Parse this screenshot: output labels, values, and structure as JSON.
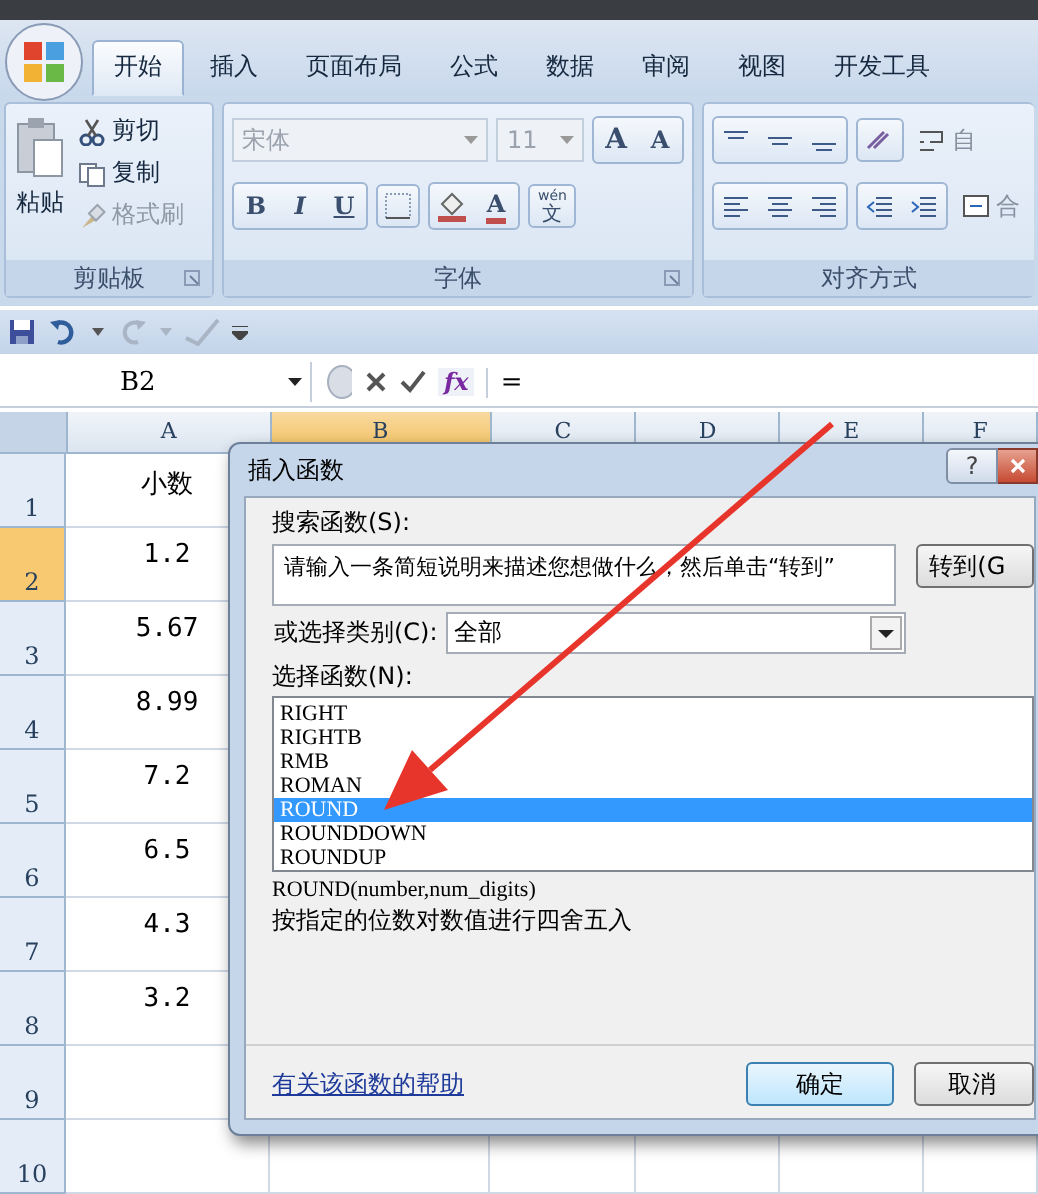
{
  "tabs": [
    {
      "label": "开始",
      "selected": true
    },
    {
      "label": "插入",
      "selected": false
    },
    {
      "label": "页面布局",
      "selected": false
    },
    {
      "label": "公式",
      "selected": false
    },
    {
      "label": "数据",
      "selected": false
    },
    {
      "label": "审阅",
      "selected": false
    },
    {
      "label": "视图",
      "selected": false
    },
    {
      "label": "开发工具",
      "selected": false
    }
  ],
  "clipboard": {
    "paste": "粘贴",
    "cut": "剪切",
    "copy": "复制",
    "painter": "格式刷",
    "label": "剪贴板"
  },
  "font": {
    "name": "宋体",
    "size": "11",
    "grow": "A",
    "shrink": "A",
    "bold": "B",
    "italic": "I",
    "underline": "U",
    "color_letter": "A",
    "phonetic_top": "wén",
    "phonetic_bottom": "文",
    "label": "字体"
  },
  "alignment": {
    "wrap": "自",
    "merge": "合",
    "label": "对齐方式"
  },
  "formula_bar": {
    "name_box": "B2",
    "fx": "fx",
    "formula": "="
  },
  "columns": [
    {
      "label": "A",
      "selected": false
    },
    {
      "label": "B",
      "selected": true
    },
    {
      "label": "C",
      "selected": false
    },
    {
      "label": "D",
      "selected": false
    },
    {
      "label": "E",
      "selected": false
    },
    {
      "label": "F",
      "selected": false
    }
  ],
  "rows": [
    {
      "number": "1",
      "a": "小数",
      "selected": false
    },
    {
      "number": "2",
      "a": "1.2",
      "selected": true
    },
    {
      "number": "3",
      "a": "5.67",
      "selected": false
    },
    {
      "number": "4",
      "a": "8.99",
      "selected": false
    },
    {
      "number": "5",
      "a": "7.2",
      "selected": false
    },
    {
      "number": "6",
      "a": "6.5",
      "selected": false
    },
    {
      "number": "7",
      "a": "4.3",
      "selected": false
    },
    {
      "number": "8",
      "a": "3.2",
      "selected": false
    },
    {
      "number": "9",
      "selected": false
    },
    {
      "number": "10",
      "selected": false
    }
  ],
  "dialog": {
    "title": "插入函数",
    "help": "?",
    "search_label": "搜索函数(S):",
    "search_value": "请输入一条简短说明来描述您想做什么，然后单击“转到”",
    "go_button": "转到(G",
    "category_label": "或选择类别(C):",
    "category": "全部",
    "list_label": "选择函数(N):",
    "functions": [
      {
        "name": "RIGHT",
        "selected": false
      },
      {
        "name": "RIGHTB",
        "selected": false
      },
      {
        "name": "RMB",
        "selected": false
      },
      {
        "name": "ROMAN",
        "selected": false
      },
      {
        "name": "ROUND",
        "selected": true
      },
      {
        "name": "ROUNDDOWN",
        "selected": false
      },
      {
        "name": "ROUNDUP",
        "selected": false
      }
    ],
    "signature": "ROUND(number,num_digits)",
    "description": "按指定的位数对数值进行四舍五入",
    "help_link": "有关该函数的帮助",
    "ok": "确定",
    "cancel": "取消"
  }
}
